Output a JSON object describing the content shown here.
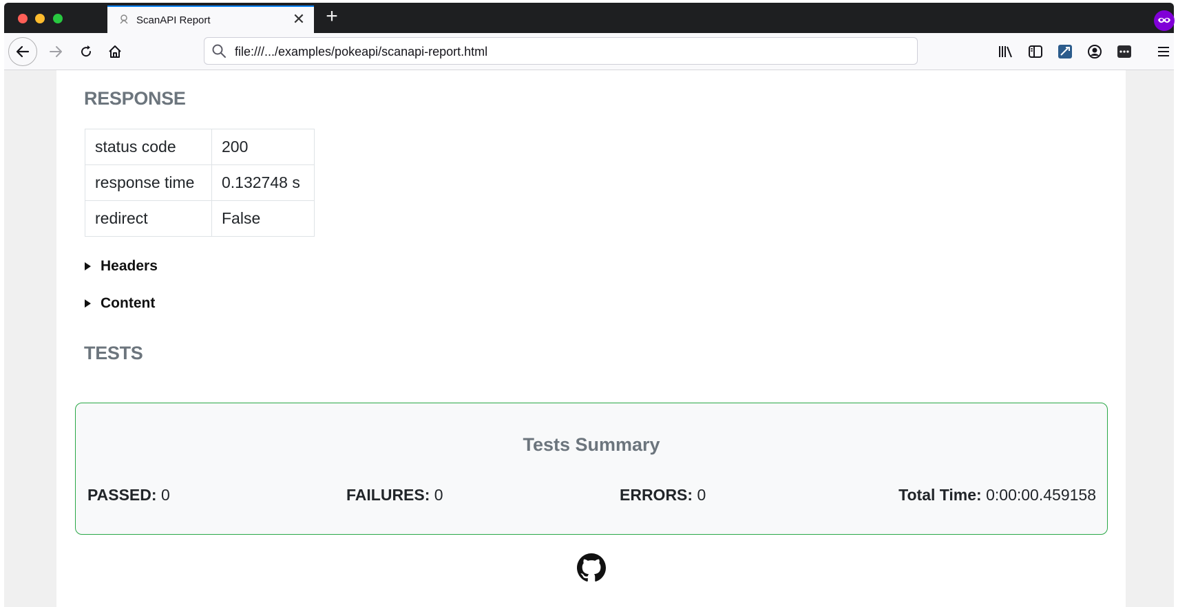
{
  "browser": {
    "tab_title": "ScanAPI Report",
    "new_tab_symbol": "+",
    "close_symbol": "✕",
    "url": "file:///.../examples/pokeapi/scanapi-report.html",
    "toolbar_icons": [
      "library-icon",
      "sidebar-icon",
      "screenshot-extension-icon",
      "account-icon",
      "extension-icon",
      "menu-icon"
    ],
    "private_color": "#8000d7",
    "accent_color": "#0a84ff"
  },
  "response": {
    "heading": "RESPONSE",
    "rows": [
      {
        "key": "status code",
        "value": "200"
      },
      {
        "key": "response time",
        "value": "0.132748 s"
      },
      {
        "key": "redirect",
        "value": "False"
      }
    ],
    "headers_label": "Headers",
    "content_label": "Content"
  },
  "tests": {
    "heading": "TESTS",
    "summary_title": "Tests Summary",
    "passed_label": "PASSED:",
    "passed_value": "0",
    "failures_label": "FAILURES:",
    "failures_value": "0",
    "errors_label": "ERRORS:",
    "errors_value": "0",
    "total_time_label": "Total Time:",
    "total_time_value": "0:00:00.459158",
    "border_color": "#28a745"
  },
  "footer": {
    "icon": "github-icon"
  }
}
